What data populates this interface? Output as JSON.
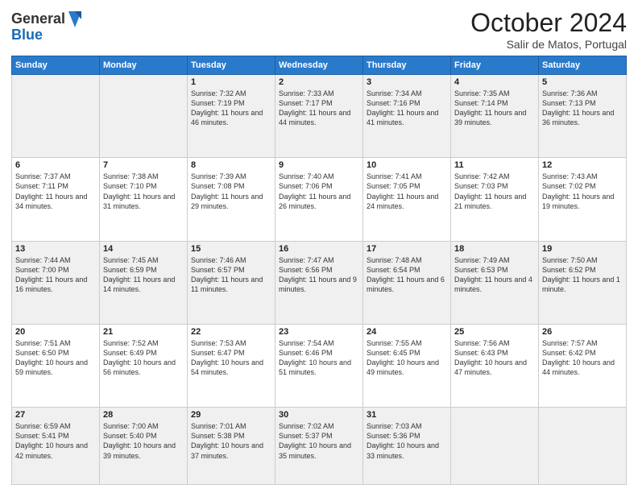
{
  "logo": {
    "general": "General",
    "blue": "Blue"
  },
  "header": {
    "month": "October 2024",
    "location": "Salir de Matos, Portugal"
  },
  "weekdays": [
    "Sunday",
    "Monday",
    "Tuesday",
    "Wednesday",
    "Thursday",
    "Friday",
    "Saturday"
  ],
  "weeks": [
    [
      {
        "day": "",
        "info": ""
      },
      {
        "day": "",
        "info": ""
      },
      {
        "day": "1",
        "info": "Sunrise: 7:32 AM\nSunset: 7:19 PM\nDaylight: 11 hours and 46 minutes."
      },
      {
        "day": "2",
        "info": "Sunrise: 7:33 AM\nSunset: 7:17 PM\nDaylight: 11 hours and 44 minutes."
      },
      {
        "day": "3",
        "info": "Sunrise: 7:34 AM\nSunset: 7:16 PM\nDaylight: 11 hours and 41 minutes."
      },
      {
        "day": "4",
        "info": "Sunrise: 7:35 AM\nSunset: 7:14 PM\nDaylight: 11 hours and 39 minutes."
      },
      {
        "day": "5",
        "info": "Sunrise: 7:36 AM\nSunset: 7:13 PM\nDaylight: 11 hours and 36 minutes."
      }
    ],
    [
      {
        "day": "6",
        "info": "Sunrise: 7:37 AM\nSunset: 7:11 PM\nDaylight: 11 hours and 34 minutes."
      },
      {
        "day": "7",
        "info": "Sunrise: 7:38 AM\nSunset: 7:10 PM\nDaylight: 11 hours and 31 minutes."
      },
      {
        "day": "8",
        "info": "Sunrise: 7:39 AM\nSunset: 7:08 PM\nDaylight: 11 hours and 29 minutes."
      },
      {
        "day": "9",
        "info": "Sunrise: 7:40 AM\nSunset: 7:06 PM\nDaylight: 11 hours and 26 minutes."
      },
      {
        "day": "10",
        "info": "Sunrise: 7:41 AM\nSunset: 7:05 PM\nDaylight: 11 hours and 24 minutes."
      },
      {
        "day": "11",
        "info": "Sunrise: 7:42 AM\nSunset: 7:03 PM\nDaylight: 11 hours and 21 minutes."
      },
      {
        "day": "12",
        "info": "Sunrise: 7:43 AM\nSunset: 7:02 PM\nDaylight: 11 hours and 19 minutes."
      }
    ],
    [
      {
        "day": "13",
        "info": "Sunrise: 7:44 AM\nSunset: 7:00 PM\nDaylight: 11 hours and 16 minutes."
      },
      {
        "day": "14",
        "info": "Sunrise: 7:45 AM\nSunset: 6:59 PM\nDaylight: 11 hours and 14 minutes."
      },
      {
        "day": "15",
        "info": "Sunrise: 7:46 AM\nSunset: 6:57 PM\nDaylight: 11 hours and 11 minutes."
      },
      {
        "day": "16",
        "info": "Sunrise: 7:47 AM\nSunset: 6:56 PM\nDaylight: 11 hours and 9 minutes."
      },
      {
        "day": "17",
        "info": "Sunrise: 7:48 AM\nSunset: 6:54 PM\nDaylight: 11 hours and 6 minutes."
      },
      {
        "day": "18",
        "info": "Sunrise: 7:49 AM\nSunset: 6:53 PM\nDaylight: 11 hours and 4 minutes."
      },
      {
        "day": "19",
        "info": "Sunrise: 7:50 AM\nSunset: 6:52 PM\nDaylight: 11 hours and 1 minute."
      }
    ],
    [
      {
        "day": "20",
        "info": "Sunrise: 7:51 AM\nSunset: 6:50 PM\nDaylight: 10 hours and 59 minutes."
      },
      {
        "day": "21",
        "info": "Sunrise: 7:52 AM\nSunset: 6:49 PM\nDaylight: 10 hours and 56 minutes."
      },
      {
        "day": "22",
        "info": "Sunrise: 7:53 AM\nSunset: 6:47 PM\nDaylight: 10 hours and 54 minutes."
      },
      {
        "day": "23",
        "info": "Sunrise: 7:54 AM\nSunset: 6:46 PM\nDaylight: 10 hours and 51 minutes."
      },
      {
        "day": "24",
        "info": "Sunrise: 7:55 AM\nSunset: 6:45 PM\nDaylight: 10 hours and 49 minutes."
      },
      {
        "day": "25",
        "info": "Sunrise: 7:56 AM\nSunset: 6:43 PM\nDaylight: 10 hours and 47 minutes."
      },
      {
        "day": "26",
        "info": "Sunrise: 7:57 AM\nSunset: 6:42 PM\nDaylight: 10 hours and 44 minutes."
      }
    ],
    [
      {
        "day": "27",
        "info": "Sunrise: 6:59 AM\nSunset: 5:41 PM\nDaylight: 10 hours and 42 minutes."
      },
      {
        "day": "28",
        "info": "Sunrise: 7:00 AM\nSunset: 5:40 PM\nDaylight: 10 hours and 39 minutes."
      },
      {
        "day": "29",
        "info": "Sunrise: 7:01 AM\nSunset: 5:38 PM\nDaylight: 10 hours and 37 minutes."
      },
      {
        "day": "30",
        "info": "Sunrise: 7:02 AM\nSunset: 5:37 PM\nDaylight: 10 hours and 35 minutes."
      },
      {
        "day": "31",
        "info": "Sunrise: 7:03 AM\nSunset: 5:36 PM\nDaylight: 10 hours and 33 minutes."
      },
      {
        "day": "",
        "info": ""
      },
      {
        "day": "",
        "info": ""
      }
    ]
  ]
}
